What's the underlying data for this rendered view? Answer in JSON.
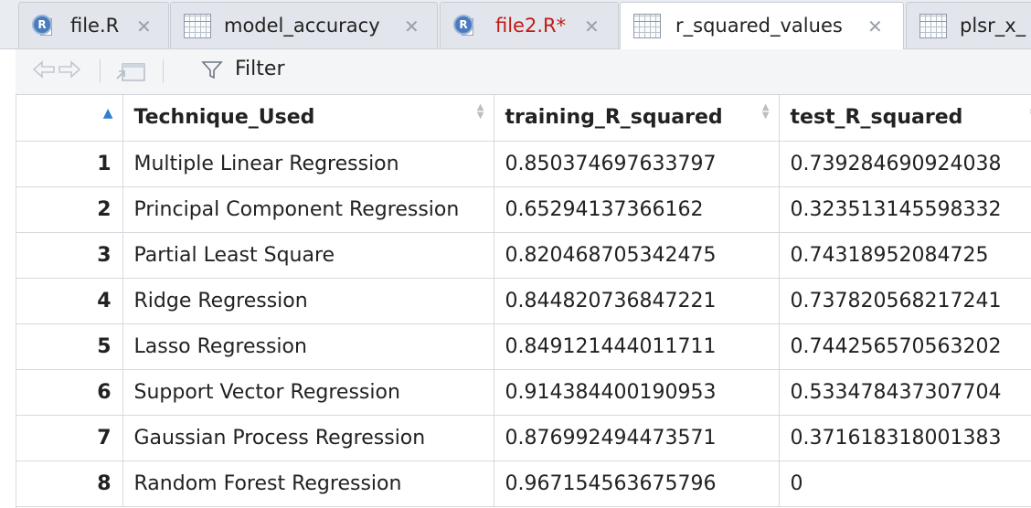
{
  "tabs": [
    {
      "label": "file.R",
      "type": "r-script",
      "modified": false,
      "active": false
    },
    {
      "label": "model_accuracy",
      "type": "data",
      "modified": false,
      "active": false
    },
    {
      "label": "file2.R*",
      "type": "r-script",
      "modified": true,
      "active": false
    },
    {
      "label": "r_squared_values",
      "type": "data",
      "modified": false,
      "active": true
    },
    {
      "label": "plsr_x_",
      "type": "data",
      "modified": false,
      "active": false
    }
  ],
  "toolbar": {
    "back_icon": "back-arrow-icon",
    "forward_icon": "forward-arrow-icon",
    "popout_icon": "popout-window-icon",
    "filter_icon": "funnel-icon",
    "filter_label": "Filter"
  },
  "table": {
    "sorted_column": "row-index",
    "sort_direction": "ascending",
    "columns": [
      "Technique_Used",
      "training_R_squared",
      "test_R_squared"
    ],
    "rows": [
      {
        "index": "1",
        "cells": [
          "Multiple Linear Regression",
          "0.850374697633797",
          "0.739284690924038"
        ]
      },
      {
        "index": "2",
        "cells": [
          "Principal Component Regression",
          "0.65294137366162",
          "0.323513145598332"
        ]
      },
      {
        "index": "3",
        "cells": [
          "Partial Least Square",
          "0.820468705342475",
          "0.74318952084725"
        ]
      },
      {
        "index": "4",
        "cells": [
          "Ridge Regression",
          "0.844820736847221",
          "0.737820568217241"
        ]
      },
      {
        "index": "5",
        "cells": [
          "Lasso Regression",
          "0.849121444011711",
          "0.744256570563202"
        ]
      },
      {
        "index": "6",
        "cells": [
          "Support Vector Regression",
          "0.914384400190953",
          "0.533478437307704"
        ]
      },
      {
        "index": "7",
        "cells": [
          "Gaussian Process Regression",
          "0.876992494473571",
          "0.371618318001383"
        ]
      },
      {
        "index": "8",
        "cells": [
          "Random Forest Regression",
          "0.967154563675796",
          "0"
        ]
      }
    ]
  },
  "colors": {
    "modified_tab_text": "#c41a16",
    "sort_indicator": "#2d7fd2",
    "r_icon": "#4a7bbd"
  }
}
